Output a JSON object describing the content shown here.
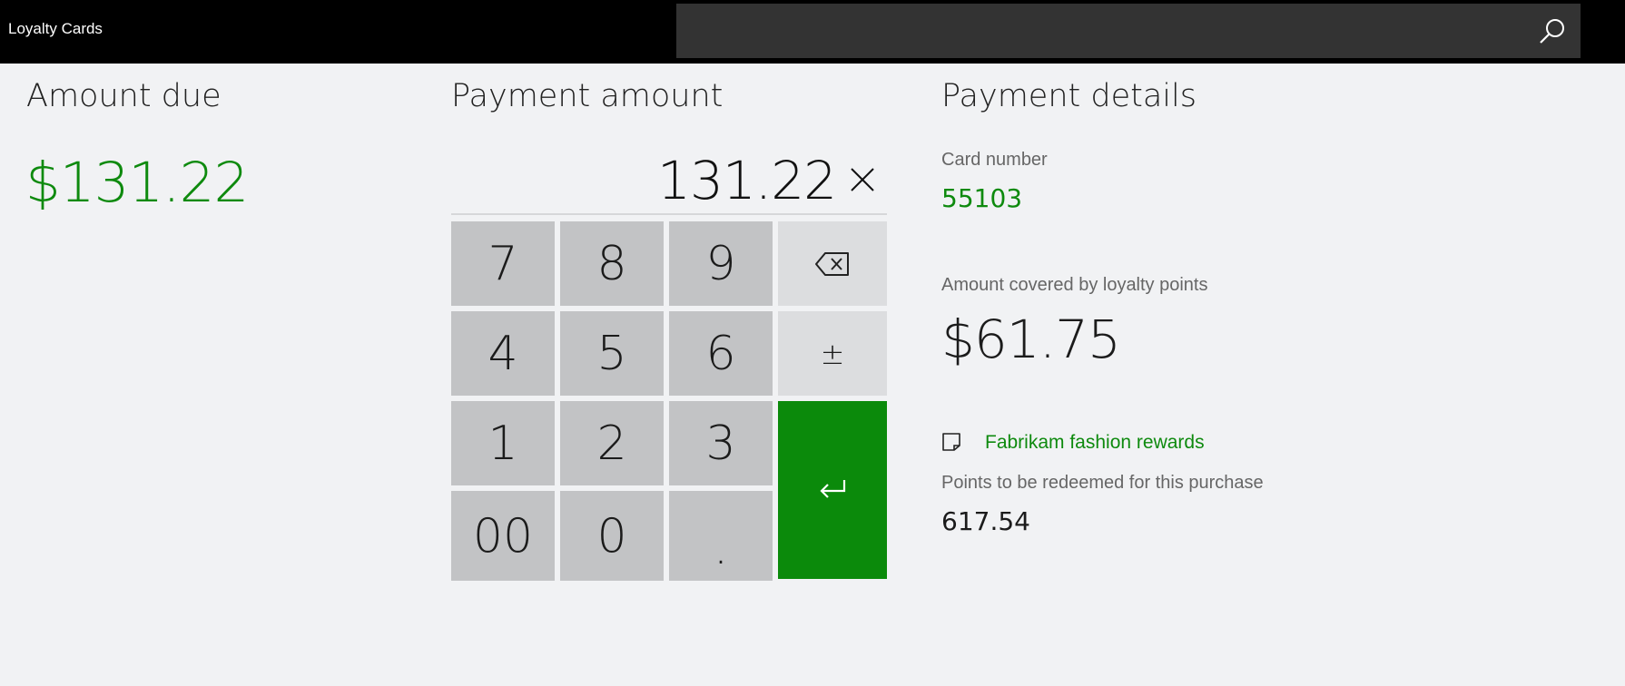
{
  "app": {
    "title": "Loyalty Cards"
  },
  "search": {
    "value": "",
    "placeholder": ""
  },
  "amount_due": {
    "label": "Amount due",
    "value": "$131.22"
  },
  "payment_amount": {
    "label": "Payment amount",
    "value": "131.22",
    "keys": {
      "k7": "7",
      "k8": "8",
      "k9": "9",
      "k4": "4",
      "k5": "5",
      "k6": "6",
      "k1": "1",
      "k2": "2",
      "k3": "3",
      "k00": "00",
      "k0": "0",
      "kdot": ".",
      "plusminus": "±"
    },
    "icons": {
      "clear": "close-icon",
      "backspace": "backspace-icon",
      "enter": "enter-icon"
    }
  },
  "payment_details": {
    "label": "Payment details",
    "card_number_label": "Card number",
    "card_number": "55103",
    "covered_label": "Amount covered by loyalty points",
    "covered_value": "$61.75",
    "program_name": "Fabrikam fashion rewards",
    "program_icon": "card-icon",
    "points_label": "Points to be redeemed for this purchase",
    "points_value": "617.54"
  },
  "colors": {
    "accent": "#0b8a0b",
    "topbar": "#000000",
    "background": "#f1f2f4"
  }
}
